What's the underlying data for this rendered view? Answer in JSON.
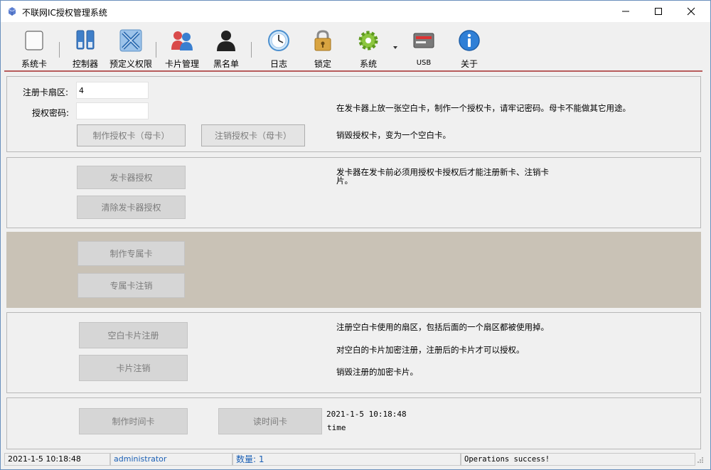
{
  "window": {
    "title": "不联网IC授权管理系统",
    "controls": {
      "minimize": "─",
      "maximize": "☐",
      "close": "✕"
    }
  },
  "toolbar": {
    "items": [
      {
        "label": "系统卡",
        "icon": "system-card-icon"
      },
      {
        "label": "控制器",
        "icon": "controller-icon"
      },
      {
        "label": "预定义权限",
        "icon": "predefined-permission-icon"
      },
      {
        "label": "卡片管理",
        "icon": "card-management-icon"
      },
      {
        "label": "黑名单",
        "icon": "blacklist-icon"
      },
      {
        "label": "日志",
        "icon": "log-clock-icon"
      },
      {
        "label": "锁定",
        "icon": "lock-icon"
      },
      {
        "label": "系统",
        "icon": "system-gear-icon"
      },
      {
        "label": "USB",
        "icon": "usb-card-reader-icon"
      },
      {
        "label": "关于",
        "icon": "about-info-icon"
      }
    ]
  },
  "auth_panel": {
    "sector_label": "注册卡扇区:",
    "sector_value": "4",
    "password_label": "授权密码:",
    "password_value": "",
    "make_auth_card_button": "制作授权卡（母卡）",
    "cancel_auth_card_button": "注销授权卡（母卡）",
    "note_make": "在发卡器上放一张空白卡，制作一个授权卡，请牢记密码。母卡不能做其它用途。",
    "note_cancel": "销毁授权卡，变为一个空白卡。"
  },
  "issuer_panel": {
    "authorize_button": "发卡器授权",
    "clear_button": "清除发卡器授权",
    "note": "发卡器在发卡前必须用授权卡授权后才能注册新卡、注销卡片。"
  },
  "exclusive_panel": {
    "make_button": "制作专属卡",
    "cancel_button": "专属卡注销"
  },
  "register_panel": {
    "register_button": "空白卡片注册",
    "cancel_button": "卡片注销",
    "note_sector": "注册空白卡使用的扇区，包括后面的一个扇区都被使用掉。",
    "note_encrypt": "对空白的卡片加密注册，注册后的卡片才可以授权。",
    "note_destroy": "销毁注册的加密卡片。"
  },
  "time_panel": {
    "make_button": "制作时间卡",
    "read_button": "读时间卡",
    "time_value": "2021-1-5 10:18:48",
    "time_label": "time"
  },
  "statusbar": {
    "datetime": "2021-1-5 10:18:48",
    "user": "administrator",
    "count": "数量: 1",
    "message": "Operations success!"
  },
  "colors": {
    "accent_line": "#b85c5c",
    "dark_panel": "#c9c2b6",
    "status_blue": "#1a5fb4"
  }
}
